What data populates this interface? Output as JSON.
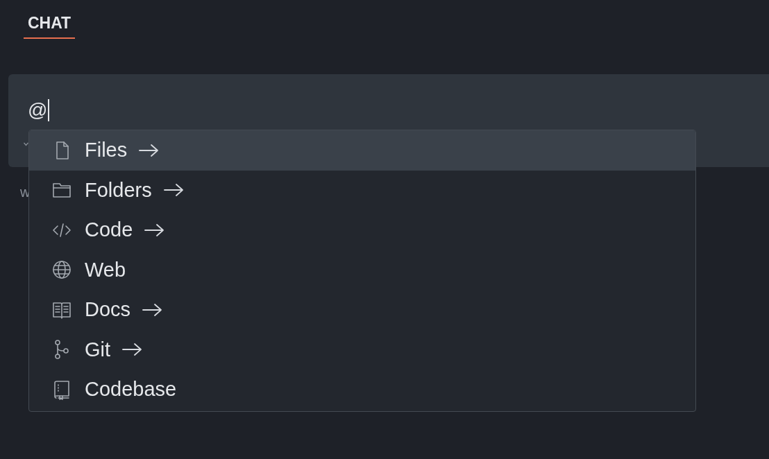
{
  "tabs": [
    {
      "label": "CHAT",
      "selected": true
    }
  ],
  "input": {
    "value": "@"
  },
  "hint_text": "w",
  "menu": [
    {
      "label": "Files",
      "kind": "file",
      "submenu": true,
      "selected": true
    },
    {
      "label": "Folders",
      "kind": "folder",
      "submenu": true,
      "selected": false
    },
    {
      "label": "Code",
      "kind": "code",
      "submenu": true,
      "selected": false
    },
    {
      "label": "Web",
      "kind": "globe",
      "submenu": false,
      "selected": false
    },
    {
      "label": "Docs",
      "kind": "book",
      "submenu": true,
      "selected": false
    },
    {
      "label": "Git",
      "kind": "branch",
      "submenu": true,
      "selected": false
    },
    {
      "label": "Codebase",
      "kind": "codebase",
      "submenu": false,
      "selected": false
    }
  ]
}
